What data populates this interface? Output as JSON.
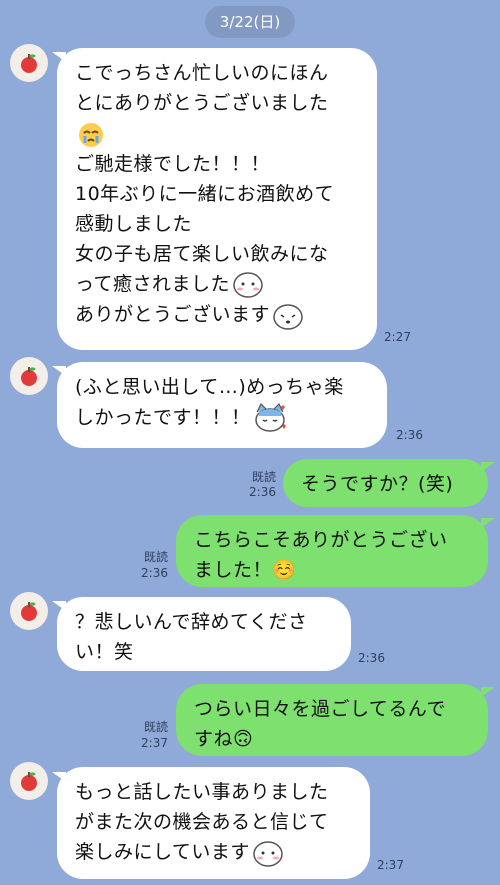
{
  "date": "3/22(日)",
  "messages": [
    {
      "lines": [
        "こでっちさん忙しいのにほん",
        "とにありがとうございました",
        "ご馳走様でした！！！",
        "10年ぶりに一緒にお酒飲めて",
        "感動しました",
        "女の子も居て楽しい飲みにな",
        "って癒されました",
        "ありがとうございます"
      ],
      "time": "2:27"
    },
    {
      "lines": [
        "(ふと思い出して…)めっちゃ楽",
        "しかったです！！！"
      ],
      "time": "2:36"
    },
    {
      "lines": [
        "そうですか？(笑)"
      ],
      "read": "既読",
      "time": "2:36"
    },
    {
      "lines": [
        "こちらこそありがとうござい",
        "ました！☺️"
      ],
      "read": "既読",
      "time": "2:36"
    },
    {
      "lines": [
        "？悲しいんで辞めてくださ",
        "い！笑"
      ],
      "time": "2:36"
    },
    {
      "lines": [
        "つらい日々を過ごしてるんで",
        "すね🙃"
      ],
      "read": "既読",
      "time": "2:37"
    },
    {
      "lines": [
        "もっと話したい事ありました",
        "がまた次の機会あると信じて",
        "楽しみにしています"
      ],
      "time": "2:37"
    }
  ],
  "icons": {
    "avatar": "apple-icon",
    "sticker_crying": "crying-face-icon",
    "sticker_hamster": "hamster-face-icon",
    "sticker_cat": "cat-hearts-icon"
  },
  "colors": {
    "background": "#8fa9d9",
    "incoming": "#ffffff",
    "outgoing": "#7ee06f"
  }
}
